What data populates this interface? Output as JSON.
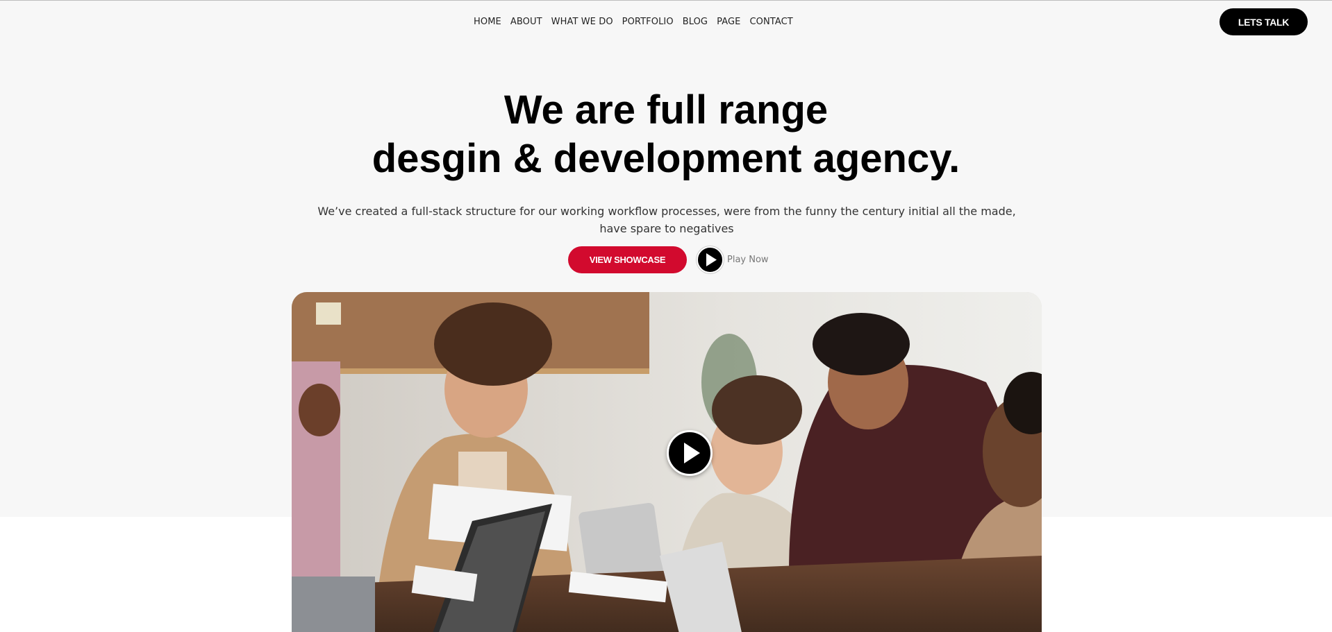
{
  "nav": {
    "items": [
      "HOME",
      "ABOUT",
      "WHAT WE DO",
      "PORTFOLIO",
      "BLOG",
      "PAGE",
      "CONTACT"
    ],
    "cta_label": "LETS TALK"
  },
  "hero": {
    "title_line1": "We are full range",
    "title_line2": "desgin & development agency.",
    "subtitle": "We’ve created a full-stack structure for our working workflow processes, were from the funny the century initial all the made, have spare to negatives",
    "showcase_label": "VIEW SHOWCASE",
    "play_label": "Play Now"
  },
  "media": {
    "description_icon": "play-icon"
  },
  "colors": {
    "accent": "#d20a2e",
    "dark": "#000000",
    "hero_background": "#f7f7f7"
  }
}
